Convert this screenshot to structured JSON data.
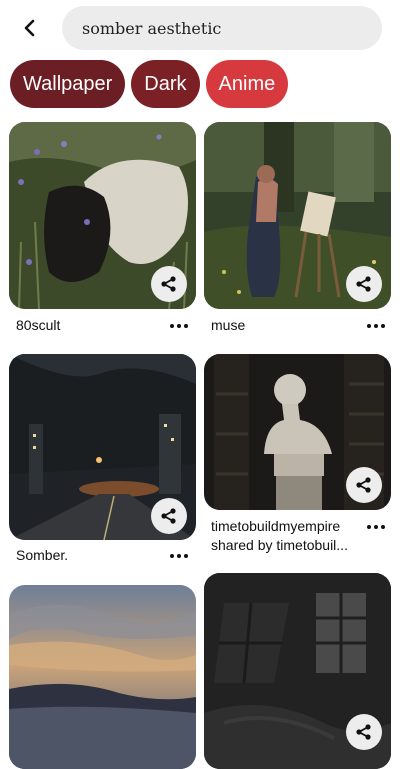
{
  "search": {
    "query": "somber aesthetic"
  },
  "chips": [
    {
      "label": "Wallpaper",
      "color": "#6b1f24"
    },
    {
      "label": "Dark",
      "color": "#7b2025"
    },
    {
      "label": "Anime",
      "color": "#d63a3e"
    }
  ],
  "pins": [
    {
      "title": "80scult"
    },
    {
      "title": "muse"
    },
    {
      "title": "Somber."
    },
    {
      "title": "timetobuildmyempire",
      "subtitle": "shared by timetobuil..."
    }
  ],
  "icons": {
    "back": "chevron-left-icon",
    "share": "share-icon",
    "more": "more-horizontal-icon"
  }
}
